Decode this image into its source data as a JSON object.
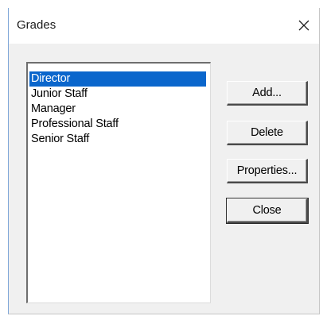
{
  "window": {
    "title": "Grades",
    "close_glyph": "✕"
  },
  "list": {
    "items": [
      {
        "label": "Director",
        "selected": true
      },
      {
        "label": "Junior Staff",
        "selected": false
      },
      {
        "label": "Manager",
        "selected": false
      },
      {
        "label": "Professional Staff",
        "selected": false
      },
      {
        "label": "Senior Staff",
        "selected": false
      }
    ]
  },
  "buttons": {
    "add": "Add...",
    "delete": "Delete",
    "properties": "Properties...",
    "close": "Close"
  },
  "colors": {
    "selection": "#0a66cc",
    "dialog_bg": "#f0f0f0"
  }
}
